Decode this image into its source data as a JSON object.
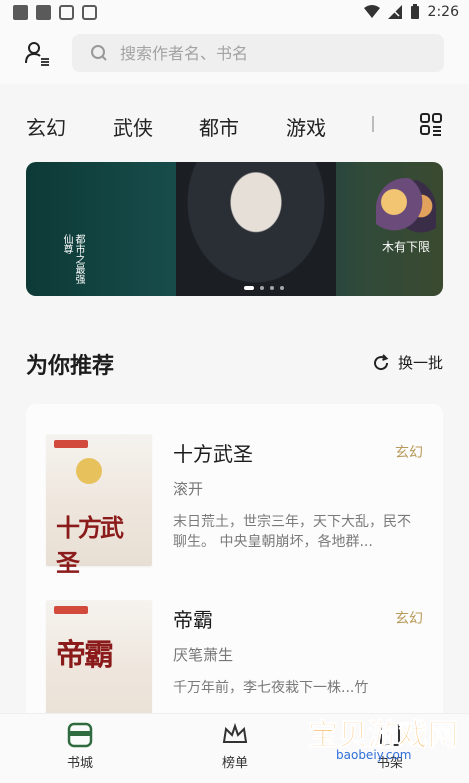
{
  "status_bar": {
    "time": "2:26"
  },
  "search": {
    "placeholder": "搜索作者名、书名"
  },
  "tabs": [
    {
      "label": "玄幻"
    },
    {
      "label": "武侠"
    },
    {
      "label": "都市"
    },
    {
      "label": "游戏"
    }
  ],
  "banner": {
    "note": "木有下限",
    "vertical_text": "都市之最强仙尊",
    "dots": 4
  },
  "recommend": {
    "title": "为你推荐",
    "refresh_label": "换一批"
  },
  "books": [
    {
      "title": "十方武圣",
      "author": "滚开",
      "tag": "玄幻",
      "description": "末日荒土，世宗三年，天下大乱，民不聊生。 中央皇朝崩坏，各地群...",
      "cover_text": "十方武圣"
    },
    {
      "title": "帝霸",
      "author": "厌笔萧生",
      "tag": "玄幻",
      "description": "千万年前，李七夜栽下一株...竹",
      "cover_text": "帝霸"
    }
  ],
  "bottom_nav": [
    {
      "label": "书城"
    },
    {
      "label": "榜单"
    },
    {
      "label": "书架"
    }
  ],
  "watermark": {
    "title": "宝贝游戏网",
    "url": "baobeiy.com"
  },
  "colors": {
    "accent": "#2f6b3f",
    "tag": "#b89a5a"
  }
}
